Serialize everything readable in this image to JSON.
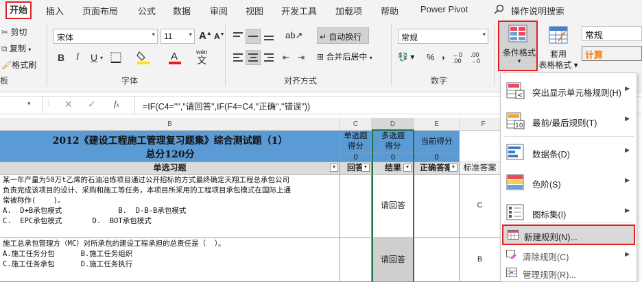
{
  "tabs": [
    "开始",
    "插入",
    "页面布局",
    "公式",
    "数据",
    "审阅",
    "视图",
    "开发工具",
    "加载项",
    "帮助",
    "Power Pivot"
  ],
  "search_label": "操作说明搜索",
  "clipboard": {
    "cut": "剪切",
    "copy": "复制",
    "painter": "格式刷",
    "group": "板"
  },
  "font": {
    "name": "宋体",
    "size": "11",
    "bold": "B",
    "italic": "I",
    "underline": "U",
    "wen": "wén",
    "group": "字体"
  },
  "alignment": {
    "wrap": "自动换行",
    "merge": "合并后居中",
    "group": "对齐方式"
  },
  "number": {
    "format": "常规",
    "percent": "%",
    "comma": ",",
    "group": "数字"
  },
  "cond_format": {
    "label": "条件格式",
    "arrow": "▾"
  },
  "table_format": {
    "line1": "套用",
    "line2": "表格格式"
  },
  "styles": {
    "normal": "常规",
    "calc": "计算"
  },
  "formula": "=IF(C4=\"\",\"请回答\",IF(F4=C4,\"正确\",\"错误\"))",
  "sheet": {
    "columns": [
      "B",
      "C",
      "D",
      "E",
      "F"
    ],
    "title": "2012《建设工程施工管理复习题集》综合测试题（1）",
    "subtitle": "总分120分",
    "c_header": "单选题\n得分",
    "d_header": "多选题\n得分",
    "e_header": "当前得分",
    "c_value": "0",
    "d_value": "0",
    "e_value": "0",
    "row3": {
      "b": "单选习题",
      "c": "回答",
      "d": "结果",
      "e": "正确答案",
      "f": "标准答案"
    },
    "q1": "某一年产量为50万t乙烯的石油冶炼项目通过公开招标的方式最终确定天翔工程总承包公司\n负责完成该项目的设计、采购和施工等任务，本项目所采用的工程项目承包模式在国际上通\n常被称作(    )。\nA.  D+B承包模式             B.  D-B-B承包模式\nC.  EPC承包模式       D.  BOT承包模式",
    "q1_result": "请回答",
    "q1_answer": "C",
    "q2": "施工总承包管理方（MC）对所承包的建设工程承担的总责任是（  ）。\nA.施工任务分包      B.施工任务组织\nC.施工任务承包      D.施工任务执行",
    "q2_result": "请回答",
    "q2_answer": "B"
  },
  "menu": {
    "items": [
      "突出显示单元格规则(H)",
      "最前/最后规则(T)",
      "数据条(D)",
      "色阶(S)",
      "图标集(I)",
      "新建规则(N)...",
      "清除规则(C)",
      "管理规则(R)..."
    ]
  },
  "colors": {
    "accent_red": "#e02020",
    "header_blue": "#5b9bd5",
    "selected_gray": "#d2d2d2"
  }
}
